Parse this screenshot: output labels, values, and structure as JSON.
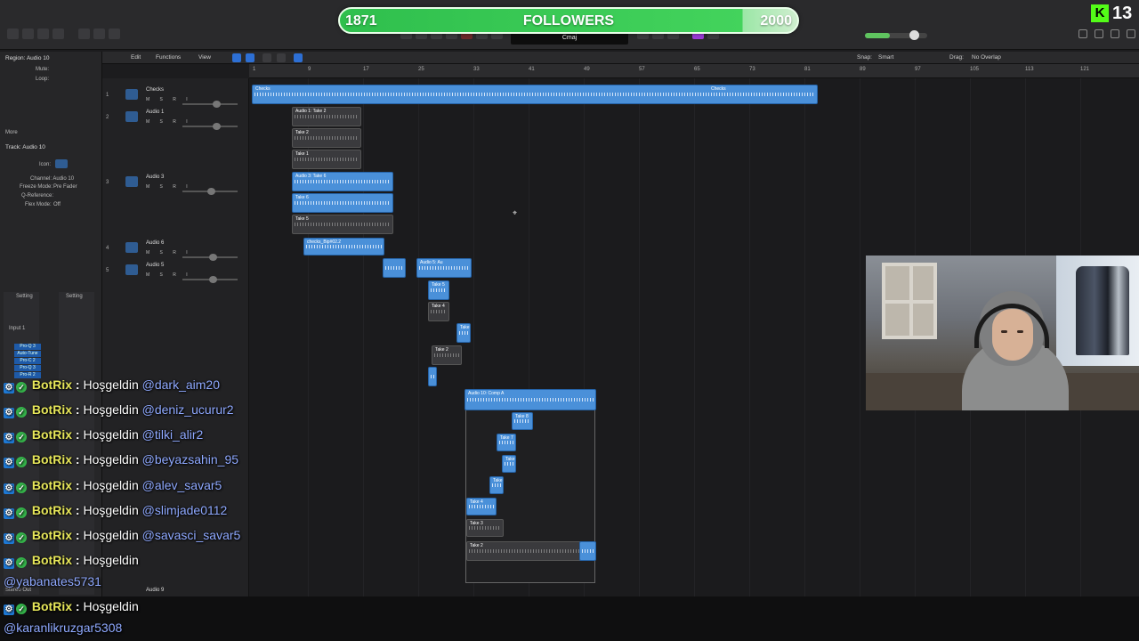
{
  "followers": {
    "current": "1871",
    "title": "FOLLOWERS",
    "goal": "2000"
  },
  "kick": {
    "logo": "K",
    "viewers": "13"
  },
  "lcd": {
    "key": "Cmaj"
  },
  "inspector": {
    "region_label": "Region: Audio 10",
    "mute": "Mute:",
    "loop": "Loop:",
    "more": "More",
    "track_label": "Track: Audio 10",
    "icon": "Icon:",
    "channel": "Channel: Audio 10",
    "freeze_mode_label": "Freeze Mode:",
    "freeze_mode_value": "Pre Fader",
    "q_reference": "Q-Reference:",
    "flex_mode_label": "Flex Mode:",
    "flex_mode_value": "Off",
    "setting_left": "Setting",
    "setting_right": "Setting",
    "input": "Input 1",
    "plugins": [
      "Pro-Q 3",
      "Auto-Tune",
      "Pro-C 2",
      "Pro-Q 3",
      "Pro-R 2"
    ],
    "stereo_out": "Stereo Out"
  },
  "editbar": {
    "edit": "Edit",
    "functions": "Functions",
    "view": "View",
    "snap_label": "Snap:",
    "snap_value": "Smart",
    "drag_label": "Drag:",
    "drag_value": "No Overlap"
  },
  "ruler": [
    "1",
    "9",
    "17",
    "25",
    "33",
    "41",
    "49",
    "57",
    "65",
    "73",
    "81",
    "89",
    "97",
    "105",
    "113",
    "121"
  ],
  "tracks": [
    {
      "num": "1",
      "name": "Checks"
    },
    {
      "num": "2",
      "name": "Audio 1"
    },
    {
      "num": "3",
      "name": "Audio 3"
    },
    {
      "num": "4",
      "name": "Audio 6"
    },
    {
      "num": "5",
      "name": "Audio 5"
    },
    {
      "num": "",
      "name": "Audio 9"
    }
  ],
  "track_buttons": "M S R I",
  "regions": {
    "checks_a": "Checks",
    "checks_b": "Checks",
    "audio1_comp": "Audio 1: Take 2",
    "take2": "Take 2",
    "take1": "Take 1",
    "audio3_comp": "Audio 3: Take 6",
    "take6": "Take 6",
    "take5": "Take 5",
    "checks_bip": "checks_Bip#02.2",
    "audio5_a": "Audio 5: Au",
    "a5_take5": "Take 5",
    "a5_take4": "Take 4",
    "a5_take": "Take",
    "a5_take2": "Take 2",
    "audio10_comp": "Audio 10: Comp A",
    "t8": "Take 8",
    "t7": "Take 7",
    "t6": "Take",
    "t5": "Take",
    "t4": "Take 4",
    "t3": "Take 3",
    "t2": "Take 2"
  },
  "chat": [
    {
      "user": "BotRix",
      "msg": "Hoşgeldin",
      "mention": "@dark_aim20"
    },
    {
      "user": "BotRix",
      "msg": "Hoşgeldin",
      "mention": "@deniz_ucurur2"
    },
    {
      "user": "BotRix",
      "msg": "Hoşgeldin",
      "mention": "@tilki_alir2"
    },
    {
      "user": "BotRix",
      "msg": "Hoşgeldin",
      "mention": "@beyazsahin_95"
    },
    {
      "user": "BotRix",
      "msg": "Hoşgeldin",
      "mention": "@alev_savar5"
    },
    {
      "user": "BotRix",
      "msg": "Hoşgeldin",
      "mention": "@slimjade0112"
    },
    {
      "user": "BotRix",
      "msg": "Hoşgeldin",
      "mention": "@savasci_savar5"
    },
    {
      "user": "BotRix",
      "msg": "Hoşgeldin",
      "mention": "@yabanates5731"
    },
    {
      "user": "BotRix",
      "msg": "Hoşgeldin",
      "mention": "@karanlikruzgar5308"
    }
  ],
  "colors": {
    "kick_green": "#53fc18",
    "region_blue": "#4a90d9",
    "goal_green": "#43d35c"
  }
}
